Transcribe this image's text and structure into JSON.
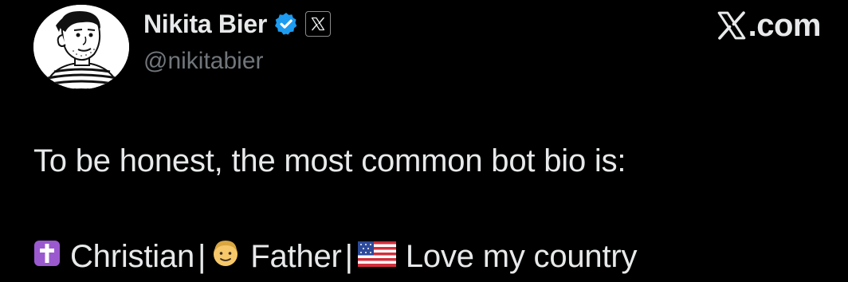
{
  "header": {
    "display_name": "Nikita Bier",
    "handle": "@nikitabier",
    "brand_text": ".com",
    "icons": {
      "verified": "verified-badge-icon",
      "affiliate": "x-logo-icon",
      "brand": "x-logo-icon"
    }
  },
  "tweet": {
    "text": "To be honest, the most common bot bio is:",
    "bio": {
      "parts": [
        {
          "icon": "latin-cross-emoji-icon",
          "text": "Christian"
        },
        {
          "separator": "|"
        },
        {
          "icon": "man-face-emoji-icon",
          "text": "Father"
        },
        {
          "separator": "|"
        },
        {
          "icon": "us-flag-emoji-icon",
          "text": "Love my country"
        }
      ]
    }
  },
  "colors": {
    "background": "#000000",
    "text_primary": "#e7e9ea",
    "text_secondary": "#71767b",
    "verified_blue": "#1d9bf0"
  }
}
